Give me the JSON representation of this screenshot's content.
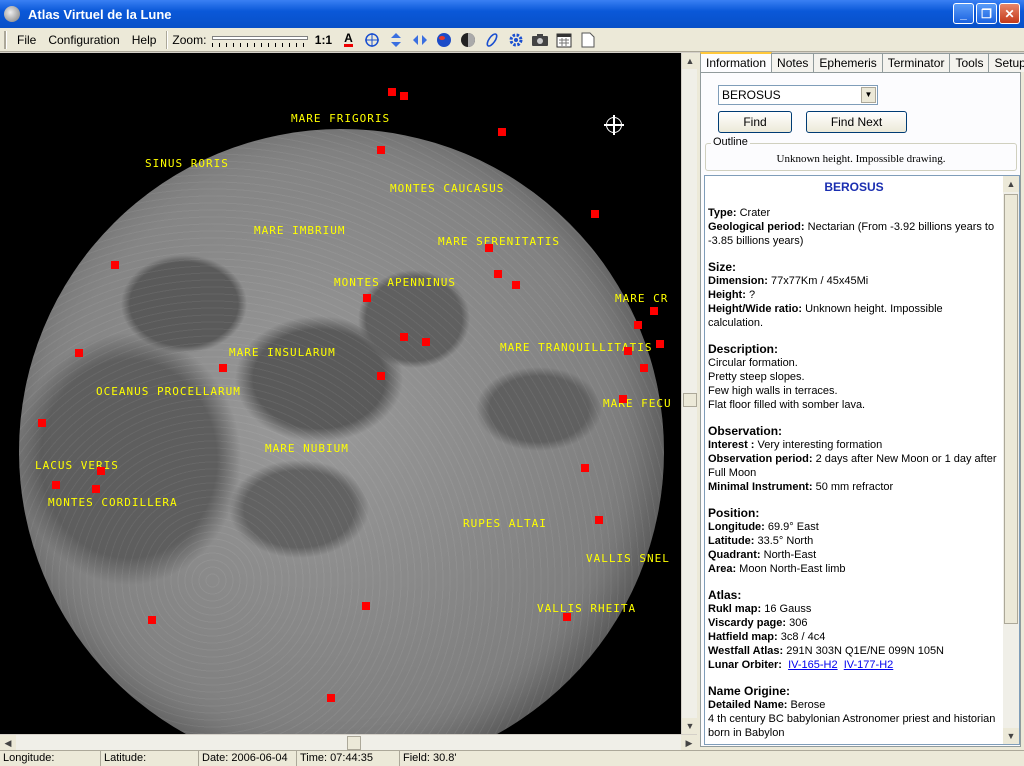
{
  "window": {
    "title": "Atlas Virtuel de la Lune"
  },
  "menu": {
    "file": "File",
    "configuration": "Configuration",
    "help": "Help"
  },
  "toolbar": {
    "zoom_label": "Zoom:",
    "zoom_1to1": "1:1"
  },
  "map_labels": [
    "MARE FRIGORIS",
    "SINUS RORIS",
    "MONTES CAUCASUS",
    "MARE IMBRIUM",
    "MARE SERENITATIS",
    "MONTES APENNINUS",
    "MARE CR",
    "MARE INSULARUM",
    "MARE TRANQUILLITATIS",
    "OCEANUS PROCELLARUM",
    "MARE FECU",
    "MARE NUBIUM",
    "LACUS VERIS",
    "MONTES CORDILLERA",
    "RUPES ALTAI",
    "VALLIS SNEL",
    "VALLIS RHEITA"
  ],
  "tabs": [
    "Information",
    "Notes",
    "Ephemeris",
    "Terminator",
    "Tools",
    "Setup"
  ],
  "search": {
    "selected": "BEROSUS",
    "find": "Find",
    "find_next": "Find Next"
  },
  "outline": {
    "legend": "Outline",
    "message": "Unknown height. Impossible drawing."
  },
  "info": {
    "title": "BEROSUS",
    "type_k": "Type:",
    "type_v": " Crater",
    "geo_k": "Geological period:",
    "geo_v": " Nectarian (From -3.92 billions years to -3.85 billions years)",
    "size_h": "Size:",
    "dim_k": "Dimension:",
    "dim_v": " 77x77Km / 45x45Mi",
    "height_k": "Height:",
    "height_v": " ?",
    "ratio_k": "Height/Wide ratio:",
    "ratio_v": " Unknown height. Impossible calculation.",
    "desc_h": "Description:",
    "desc_1": "Circular formation.",
    "desc_2": "Pretty steep slopes.",
    "desc_3": "Few high walls in terraces.",
    "desc_4": "Flat floor filled with somber lava.",
    "obs_h": "Observation:",
    "interest_k": "Interest :",
    "interest_v": " Very interesting formation",
    "obsp_k": "Observation period:",
    "obsp_v": " 2 days after New Moon or 1 day after Full Moon",
    "inst_k": "Minimal Instrument:",
    "inst_v": " 50 mm refractor",
    "pos_h": "Position:",
    "lon_k": "Longitude:",
    "lon_v": " 69.9° East",
    "lat_k": "Latitude:",
    "lat_v": " 33.5° North",
    "quad_k": "Quadrant:",
    "quad_v": " North-East",
    "area_k": "Area:",
    "area_v": " Moon North-East limb",
    "atlas_h": "Atlas:",
    "rukl_k": "Rukl map:",
    "rukl_v": " 16 Gauss",
    "visc_k": "Viscardy page:",
    "visc_v": " 306",
    "hat_k": "Hatfield map:",
    "hat_v": " 3c8 / 4c4",
    "west_k": "Westfall Atlas:",
    "west_v": " 291N 303N Q1E/NE 099N 105N",
    "lo_k": "Lunar Orbiter:",
    "lo_link1": "IV-165-H2",
    "lo_link2": "IV-177-H2",
    "name_h": "Name Origine:",
    "det_k": "Detailed Name:",
    "det_v": " Berose",
    "det_desc": "4 th century BC babylonian Astronomer priest and historian born in Babylon"
  },
  "status": {
    "longitude": "Longitude:",
    "latitude": "Latitude:",
    "date": "Date: 2006-06-04",
    "time": "Time: 07:44:35",
    "field": "Field: 30.8'"
  },
  "colors": {
    "label": "#ffff00",
    "marker": "#ff0000",
    "title_bar": "#0a58d8",
    "info_title": "#1a2eb0"
  }
}
